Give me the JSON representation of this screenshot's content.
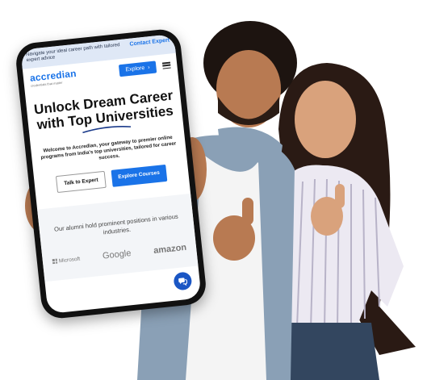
{
  "banner": {
    "text": "Navigate your ideal career path with tailored expert advice",
    "cta": "Contact Expert"
  },
  "nav": {
    "logo": "accredian",
    "logo_tagline": "credentials that matter",
    "explore_button": "Explore",
    "explore_chevron": "›"
  },
  "hero": {
    "title": "Unlock Dream Career with Top Universities",
    "description": "Welcome to Accredian, your gateway to premier online programs from India's top universities, tailored for career success.",
    "talk_button": "Talk to Expert",
    "courses_button": "Explore Courses"
  },
  "alumni": {
    "text": "Our alumni hold prominent positions in various industries.",
    "logos": [
      "Microsoft",
      "Google",
      "amazon"
    ]
  },
  "icons": {
    "menu": "hamburger-menu-icon",
    "call": "phone-call-icon"
  },
  "colors": {
    "brand_blue": "#1a73e8",
    "banner_bg": "#dfe8f6",
    "call_button": "#1a56c4"
  }
}
